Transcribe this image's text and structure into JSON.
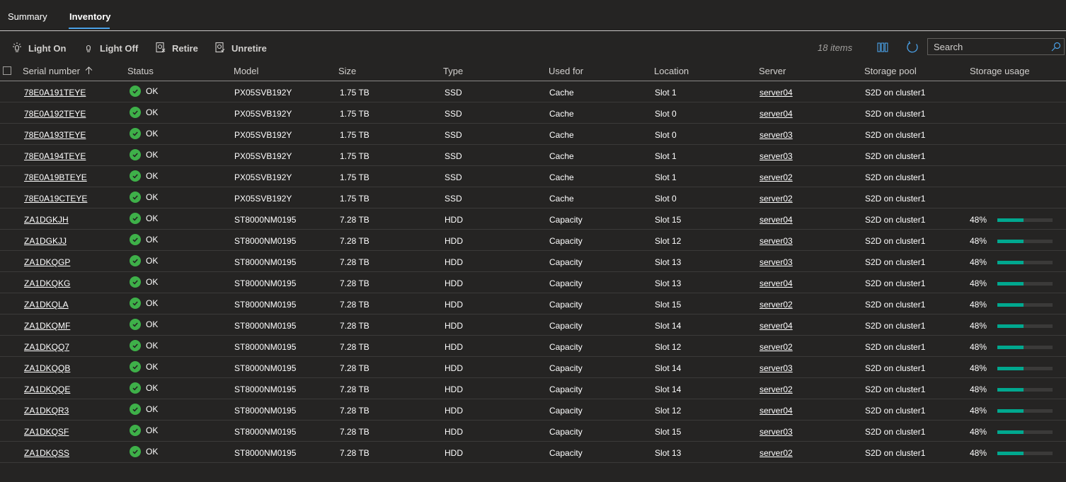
{
  "tabs": [
    {
      "label": "Summary",
      "active": false
    },
    {
      "label": "Inventory",
      "active": true
    }
  ],
  "toolbar": {
    "light_on": "Light On",
    "light_off": "Light Off",
    "retire": "Retire",
    "unretire": "Unretire",
    "items_count": "18 items",
    "search_placeholder": "Search"
  },
  "columns": {
    "serial": "Serial number",
    "status": "Status",
    "model": "Model",
    "size": "Size",
    "type": "Type",
    "used_for": "Used for",
    "location": "Location",
    "server": "Server",
    "pool": "Storage pool",
    "usage": "Storage usage"
  },
  "sort": {
    "column": "serial",
    "direction": "ascending"
  },
  "colors": {
    "accent": "#4aa0e6",
    "ok": "#3eb049",
    "usage": "#00a88f",
    "link": "#8cc4f2"
  },
  "rows": [
    {
      "serial": "78E0A191TEYE",
      "status": "OK",
      "model": "PX05SVB192Y",
      "size": "1.75 TB",
      "type": "SSD",
      "used_for": "Cache",
      "location": "Slot 1",
      "server": "server04",
      "pool": "S2D on cluster1",
      "usage": "",
      "usage_fraction": null
    },
    {
      "serial": "78E0A192TEYE",
      "status": "OK",
      "model": "PX05SVB192Y",
      "size": "1.75 TB",
      "type": "SSD",
      "used_for": "Cache",
      "location": "Slot 0",
      "server": "server04",
      "pool": "S2D on cluster1",
      "usage": "",
      "usage_fraction": null
    },
    {
      "serial": "78E0A193TEYE",
      "status": "OK",
      "model": "PX05SVB192Y",
      "size": "1.75 TB",
      "type": "SSD",
      "used_for": "Cache",
      "location": "Slot 0",
      "server": "server03",
      "pool": "S2D on cluster1",
      "usage": "",
      "usage_fraction": null
    },
    {
      "serial": "78E0A194TEYE",
      "status": "OK",
      "model": "PX05SVB192Y",
      "size": "1.75 TB",
      "type": "SSD",
      "used_for": "Cache",
      "location": "Slot 1",
      "server": "server03",
      "pool": "S2D on cluster1",
      "usage": "",
      "usage_fraction": null
    },
    {
      "serial": "78E0A19BTEYE",
      "status": "OK",
      "model": "PX05SVB192Y",
      "size": "1.75 TB",
      "type": "SSD",
      "used_for": "Cache",
      "location": "Slot 1",
      "server": "server02",
      "pool": "S2D on cluster1",
      "usage": "",
      "usage_fraction": null
    },
    {
      "serial": "78E0A19CTEYE",
      "status": "OK",
      "model": "PX05SVB192Y",
      "size": "1.75 TB",
      "type": "SSD",
      "used_for": "Cache",
      "location": "Slot 0",
      "server": "server02",
      "pool": "S2D on cluster1",
      "usage": "",
      "usage_fraction": null
    },
    {
      "serial": "ZA1DGKJH",
      "status": "OK",
      "model": "ST8000NM0195",
      "size": "7.28 TB",
      "type": "HDD",
      "used_for": "Capacity",
      "location": "Slot 15",
      "server": "server04",
      "pool": "S2D on cluster1",
      "usage": "48%",
      "usage_fraction": 0.48
    },
    {
      "serial": "ZA1DGKJJ",
      "status": "OK",
      "model": "ST8000NM0195",
      "size": "7.28 TB",
      "type": "HDD",
      "used_for": "Capacity",
      "location": "Slot 12",
      "server": "server03",
      "pool": "S2D on cluster1",
      "usage": "48%",
      "usage_fraction": 0.48
    },
    {
      "serial": "ZA1DKQGP",
      "status": "OK",
      "model": "ST8000NM0195",
      "size": "7.28 TB",
      "type": "HDD",
      "used_for": "Capacity",
      "location": "Slot 13",
      "server": "server03",
      "pool": "S2D on cluster1",
      "usage": "48%",
      "usage_fraction": 0.48
    },
    {
      "serial": "ZA1DKQKG",
      "status": "OK",
      "model": "ST8000NM0195",
      "size": "7.28 TB",
      "type": "HDD",
      "used_for": "Capacity",
      "location": "Slot 13",
      "server": "server04",
      "pool": "S2D on cluster1",
      "usage": "48%",
      "usage_fraction": 0.48
    },
    {
      "serial": "ZA1DKQLA",
      "status": "OK",
      "model": "ST8000NM0195",
      "size": "7.28 TB",
      "type": "HDD",
      "used_for": "Capacity",
      "location": "Slot 15",
      "server": "server02",
      "pool": "S2D on cluster1",
      "usage": "48%",
      "usage_fraction": 0.48
    },
    {
      "serial": "ZA1DKQMF",
      "status": "OK",
      "model": "ST8000NM0195",
      "size": "7.28 TB",
      "type": "HDD",
      "used_for": "Capacity",
      "location": "Slot 14",
      "server": "server04",
      "pool": "S2D on cluster1",
      "usage": "48%",
      "usage_fraction": 0.48
    },
    {
      "serial": "ZA1DKQQ7",
      "status": "OK",
      "model": "ST8000NM0195",
      "size": "7.28 TB",
      "type": "HDD",
      "used_for": "Capacity",
      "location": "Slot 12",
      "server": "server02",
      "pool": "S2D on cluster1",
      "usage": "48%",
      "usage_fraction": 0.48
    },
    {
      "serial": "ZA1DKQQB",
      "status": "OK",
      "model": "ST8000NM0195",
      "size": "7.28 TB",
      "type": "HDD",
      "used_for": "Capacity",
      "location": "Slot 14",
      "server": "server03",
      "pool": "S2D on cluster1",
      "usage": "48%",
      "usage_fraction": 0.48
    },
    {
      "serial": "ZA1DKQQE",
      "status": "OK",
      "model": "ST8000NM0195",
      "size": "7.28 TB",
      "type": "HDD",
      "used_for": "Capacity",
      "location": "Slot 14",
      "server": "server02",
      "pool": "S2D on cluster1",
      "usage": "48%",
      "usage_fraction": 0.48
    },
    {
      "serial": "ZA1DKQR3",
      "status": "OK",
      "model": "ST8000NM0195",
      "size": "7.28 TB",
      "type": "HDD",
      "used_for": "Capacity",
      "location": "Slot 12",
      "server": "server04",
      "pool": "S2D on cluster1",
      "usage": "48%",
      "usage_fraction": 0.48
    },
    {
      "serial": "ZA1DKQSF",
      "status": "OK",
      "model": "ST8000NM0195",
      "size": "7.28 TB",
      "type": "HDD",
      "used_for": "Capacity",
      "location": "Slot 15",
      "server": "server03",
      "pool": "S2D on cluster1",
      "usage": "48%",
      "usage_fraction": 0.48
    },
    {
      "serial": "ZA1DKQSS",
      "status": "OK",
      "model": "ST8000NM0195",
      "size": "7.28 TB",
      "type": "HDD",
      "used_for": "Capacity",
      "location": "Slot 13",
      "server": "server02",
      "pool": "S2D on cluster1",
      "usage": "48%",
      "usage_fraction": 0.48
    }
  ]
}
